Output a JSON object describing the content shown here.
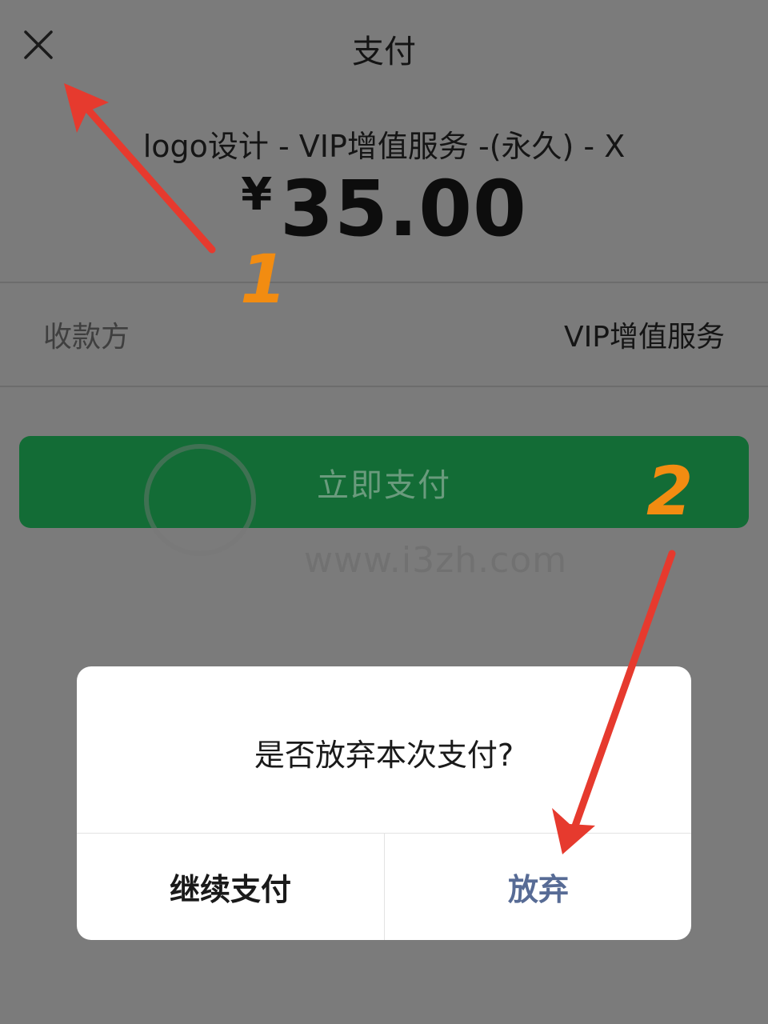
{
  "nav": {
    "title": "支付",
    "close_icon": "close-icon"
  },
  "order": {
    "product": "logo设计 - VIP增值服务 -(永久) - X",
    "currency": "¥",
    "amount": "35.00"
  },
  "payee": {
    "label": "收款方",
    "value": "VIP增值服务"
  },
  "pay_button": {
    "label": "立即支付",
    "color": "#136c36"
  },
  "watermark": {
    "url": "www.i3zh.com"
  },
  "annotations": {
    "step1": "1",
    "step2": "2",
    "arrow_color": "#e63a2e",
    "number_color": "#f28c11"
  },
  "dialog": {
    "message": "是否放弃本次支付?",
    "continue_label": "继续支付",
    "abandon_label": "放弃",
    "abandon_color": "#576b95"
  }
}
